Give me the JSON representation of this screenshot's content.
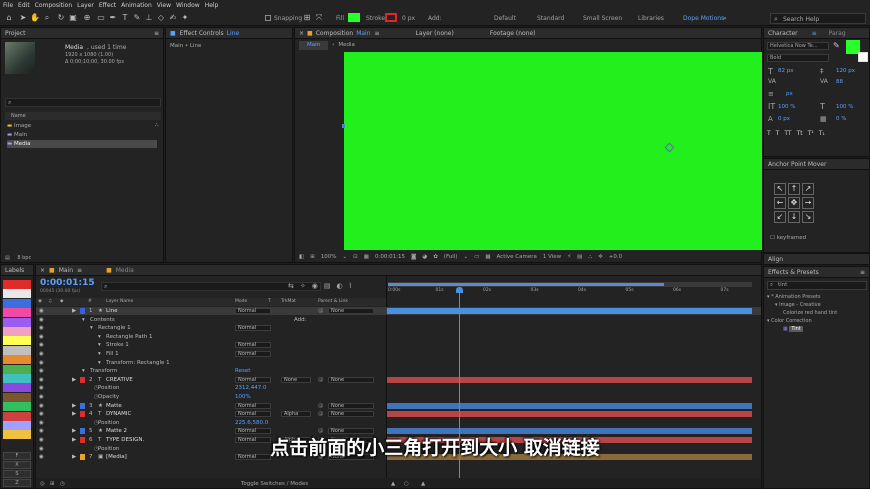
{
  "menu": [
    "File",
    "Edit",
    "Composition",
    "Layer",
    "Effect",
    "Animation",
    "View",
    "Window",
    "Help"
  ],
  "toolbar": {
    "snapping": "Snapping",
    "fill": "Fill",
    "stroke": "Stroke",
    "stroke_px": "0 px",
    "add": "Add:",
    "fill_color": "#29ff29",
    "stroke_color": "#e0262a",
    "workspaces": [
      "Default",
      "Standard",
      "Small Screen",
      "Libraries"
    ],
    "active_workspace": "Dope Motions",
    "search": "Search Help"
  },
  "project": {
    "title": "Project",
    "item_name": "Media",
    "item_used": ", used 1 time",
    "item_size": "1920 x 1080 (1.00)",
    "item_duration": "Δ 0;00;10;00, 30.00 fps",
    "name_header": "Name",
    "items": [
      "Image",
      "Main",
      "Media"
    ],
    "bpc": "8 bpc"
  },
  "effect_controls": {
    "title": "Effect Controls",
    "layer": "Line",
    "sub": "Main • Line"
  },
  "composition": {
    "title": "Composition",
    "name": "Main",
    "layer_tab": "Layer (none)",
    "footage_tab": "Footage (none)",
    "crumbs": [
      "Main",
      "Media"
    ],
    "canvas_color": "#22f01d",
    "zoom": "100%",
    "timecode": "0:00:01:15",
    "resolution": "(Full)",
    "camera": "Active Camera",
    "view": "1 View",
    "exposure": "+0.0"
  },
  "character": {
    "title": "Character",
    "tab2": "Parag",
    "font": "Helvetica Now Te...",
    "style": "Bold",
    "size": "82 px",
    "leading": "120 px",
    "tracking": "88",
    "stroke_unit": "px",
    "vscale": "100 %",
    "hscale": "100 %",
    "baseline": "0 px",
    "tsume": "0 %"
  },
  "anchor": {
    "title": "Anchor Point Mover",
    "keyframed": "keyframed",
    "arrows": [
      "↖",
      "↑",
      "↗",
      "←",
      "✥",
      "→",
      "↙",
      "↓",
      "↘"
    ]
  },
  "align": {
    "title": "Align"
  },
  "effects": {
    "title": "Effects & Presets",
    "search": "tint",
    "tree": [
      {
        "text": "▾ * Animation Presets",
        "indent": 0
      },
      {
        "text": "▾ Image - Creative",
        "indent": 1
      },
      {
        "text": "Colorize red hand tint",
        "indent": 2
      },
      {
        "text": "▾ Color Correction",
        "indent": 0
      },
      {
        "text": "Tint",
        "indent": 2
      }
    ]
  },
  "labels_panel": {
    "title": "Labels",
    "colors": [
      "#e02b2b",
      "#e8e8e8",
      "#3b6fe0",
      "#f04aa6",
      "#9b5cf0",
      "#f0a0c0",
      "#ffff55",
      "#c0c0c0",
      "#e88a2e",
      "#4caf50",
      "#40c0c0",
      "#8a4ae0",
      "#7a5530",
      "#30c060",
      "#d04040",
      "#a0a0ff",
      "#f0c040"
    ],
    "btns": [
      "F",
      "X",
      "S",
      "Z"
    ]
  },
  "timeline": {
    "tab1": "Main",
    "tab2": "Media",
    "timecode": "0:00:01:15",
    "frames": "00045 (30.00 fps)",
    "headers": {
      "name": "Layer Name",
      "mode": "Mode",
      "trkmat": "TrkMat",
      "parent": "Parent & Link"
    },
    "ruler": [
      "0:00s",
      "01s",
      "02s",
      "03s",
      "04s",
      "05s",
      "06s",
      "07s"
    ],
    "toggle": "Toggle Switches / Modes",
    "rows": [
      {
        "num": "1",
        "icon": "★",
        "name": "Line",
        "mode": "Normal",
        "trk": "",
        "parent": "None",
        "color": "#3b5fe0",
        "bar": "#4a90e0",
        "level": 0,
        "sel": true
      },
      {
        "num": "",
        "icon": "",
        "name": "Contents",
        "mode": "",
        "trk": "",
        "parent": "",
        "add": "Add:",
        "level": 1
      },
      {
        "num": "",
        "icon": "",
        "name": "Rectangle 1",
        "mode": "Normal",
        "trk": "",
        "parent": "",
        "level": 2
      },
      {
        "num": "",
        "icon": "",
        "name": "Rectangle Path 1",
        "mode": "",
        "trk": "",
        "parent": "",
        "level": 3
      },
      {
        "num": "",
        "icon": "",
        "name": "Stroke 1",
        "mode": "Normal",
        "trk": "",
        "parent": "",
        "level": 3
      },
      {
        "num": "",
        "icon": "",
        "name": "Fill 1",
        "mode": "Normal",
        "trk": "",
        "parent": "",
        "level": 3
      },
      {
        "num": "",
        "icon": "",
        "name": "Transform: Rectangle 1",
        "mode": "",
        "trk": "",
        "parent": "",
        "level": 3
      },
      {
        "num": "",
        "icon": "",
        "name": "Transform",
        "mode": "",
        "trk": "",
        "parent": "",
        "reset": "Reset",
        "level": 1
      },
      {
        "num": "2",
        "icon": "T",
        "name": "CREATIVE",
        "mode": "Normal",
        "trk": "None",
        "parent": "None",
        "color": "#e02b2b",
        "bar": "#b84545",
        "level": 0
      },
      {
        "num": "",
        "icon": "",
        "name": "Position",
        "mode": "",
        "value": "2312,447.0",
        "level": 2
      },
      {
        "num": "",
        "icon": "",
        "name": "Opacity",
        "mode": "",
        "value": "100%",
        "level": 2
      },
      {
        "num": "3",
        "icon": "★",
        "name": "Matte",
        "mode": "Normal",
        "trk": "",
        "parent": "None",
        "color": "#3b6fe0",
        "bar": "#3f74b8",
        "level": 0
      },
      {
        "num": "4",
        "icon": "T",
        "name": "DYNAMIC",
        "mode": "Normal",
        "trk": "Alpha",
        "parent": "None",
        "color": "#e02b2b",
        "bar": "#b84545",
        "level": 0
      },
      {
        "num": "",
        "icon": "",
        "name": "Position",
        "mode": "",
        "value": "225.6,580.0",
        "level": 2
      },
      {
        "num": "5",
        "icon": "★",
        "name": "Matte 2",
        "mode": "Normal",
        "trk": "",
        "parent": "None",
        "color": "#3b6fe0",
        "bar": "#3f74b8",
        "level": 0
      },
      {
        "num": "6",
        "icon": "T",
        "name": "TYPE DESIGN.",
        "mode": "Normal",
        "trk": "Alpha",
        "parent": "None",
        "color": "#e02b2b",
        "bar": "#b84545",
        "level": 0
      },
      {
        "num": "",
        "icon": "",
        "name": "Position",
        "mode": "",
        "value": "",
        "level": 2
      },
      {
        "num": "7",
        "icon": "▣",
        "name": "[Media]",
        "mode": "Normal",
        "trk": "",
        "parent": "None",
        "color": "#e8a030",
        "bar": "#8a6a3a",
        "level": 0
      }
    ]
  },
  "subtitle": "点击前面的小三角打开到大小 取消链接"
}
